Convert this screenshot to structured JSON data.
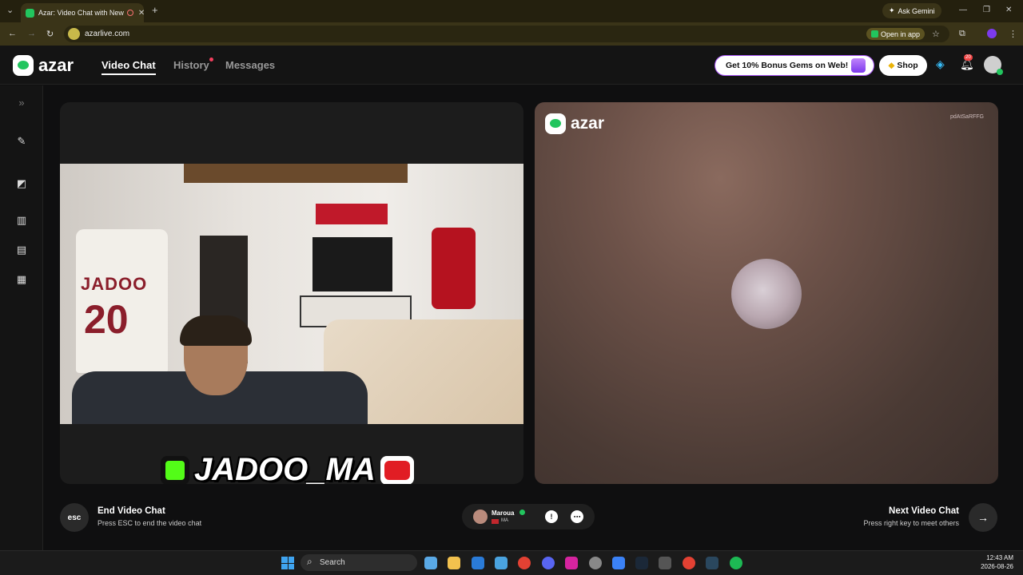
{
  "browser": {
    "tab_title": "Azar: Video Chat with New",
    "close_symbol": "✕",
    "new_tab_symbol": "+",
    "ask_gemini": "Ask Gemini",
    "url": "azarlive.com",
    "open_in_app": "Open in app"
  },
  "header": {
    "logo": "azar",
    "nav": [
      "Video Chat",
      "History",
      "Messages"
    ],
    "promo": "Get 10% Bonus Gems on Web!",
    "shop": "Shop",
    "notification_count": "20"
  },
  "remote": {
    "logo": "azar",
    "id": "pdAtSaRFFG"
  },
  "local": {
    "watermark": "JADOO_MA",
    "jersey_name": "JADOO",
    "jersey_number": "20"
  },
  "controls": {
    "esc_label": "esc",
    "end_title": "End Video Chat",
    "end_sub": "Press ESC to end the video chat",
    "partner_name": "Maroua",
    "partner_country": "MA",
    "next_title": "Next Video Chat",
    "next_sub": "Press right key to meet others"
  },
  "taskbar": {
    "search": "Search",
    "time": "12:43 AM",
    "date": "2026-08-26"
  },
  "colors": {
    "accent_green": "#22c55e",
    "promo_border": "#a855f7"
  }
}
